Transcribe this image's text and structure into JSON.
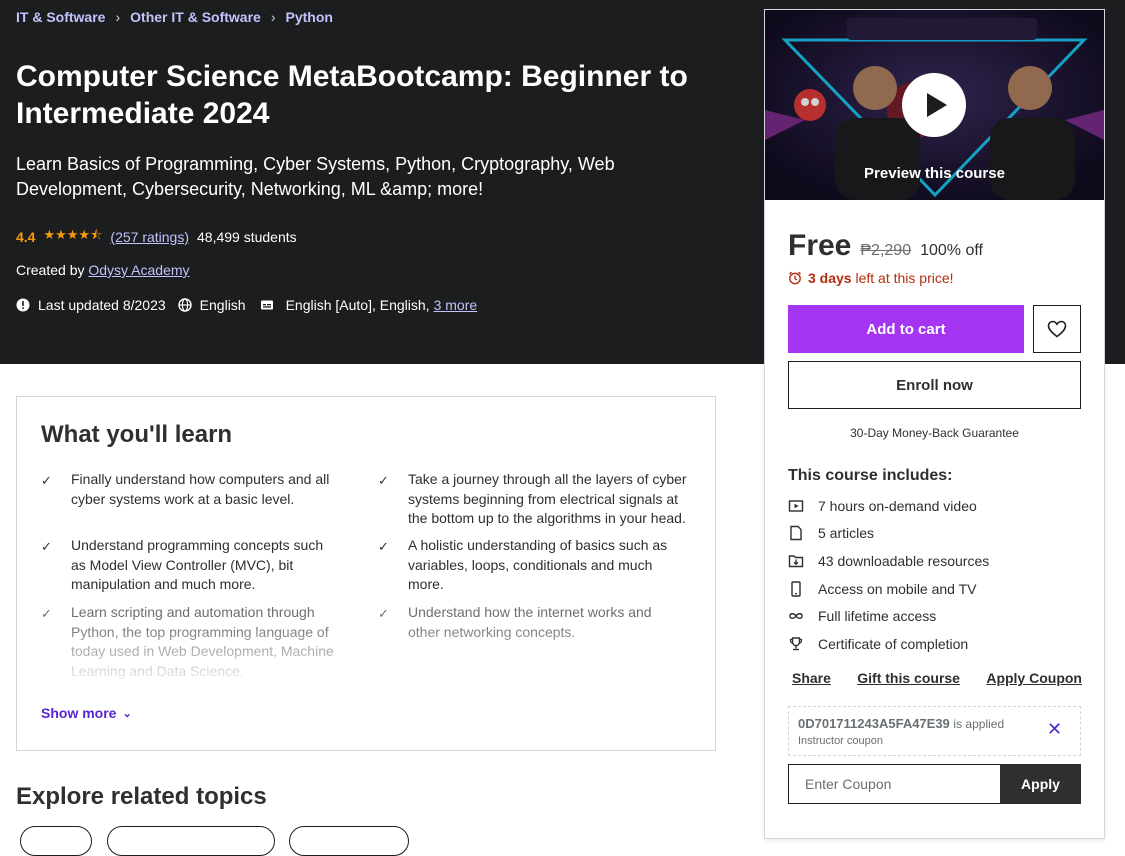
{
  "breadcrumb": [
    "IT & Software",
    "Other IT & Software",
    "Python"
  ],
  "course": {
    "title": "Computer Science MetaBootcamp: Beginner to Intermediate 2024",
    "subtitle": "Learn Basics of Programming, Cyber Systems, Python, Cryptography, Web Development, Cybersecurity, Networking, ML &amp; more!",
    "rating": "4.4",
    "ratings_link": "(257 ratings)",
    "students": "48,499 students",
    "created_by_label": "Created by",
    "author": "Odysy Academy",
    "last_updated": "Last updated 8/2023",
    "language": "English",
    "captions": "English [Auto], English,",
    "captions_more": "3 more"
  },
  "learn": {
    "title": "What you'll learn",
    "items": [
      "Finally understand how computers and all cyber systems work at a basic level.",
      "Take a journey through all the layers of cyber systems beginning from electrical signals at the bottom up to the algorithms in your head.",
      "Understand programming concepts such as Model View Controller (MVC), bit manipulation and much more.",
      "A holistic understanding of basics such as variables, loops, conditionals and much more.",
      "Learn scripting and automation through Python, the top programming language of today used in Web Development, Machine Learning and Data Science.",
      "Understand how the internet works and other networking concepts."
    ],
    "show_more": "Show more"
  },
  "explore_title": "Explore related topics",
  "card": {
    "preview_label": "Preview this course",
    "price": "Free",
    "original_price": "₱2,290",
    "discount": "100% off",
    "deadline_bold": "3 days",
    "deadline_rest": "left at this price!",
    "add_to_cart": "Add to cart",
    "enroll": "Enroll now",
    "guarantee": "30-Day Money-Back Guarantee",
    "includes_title": "This course includes:",
    "includes": [
      {
        "icon": "video-icon",
        "label": "7 hours on-demand video"
      },
      {
        "icon": "article-icon",
        "label": "5 articles"
      },
      {
        "icon": "download-icon",
        "label": "43 downloadable resources"
      },
      {
        "icon": "mobile-icon",
        "label": "Access on mobile and TV"
      },
      {
        "icon": "infinity-icon",
        "label": "Full lifetime access"
      },
      {
        "icon": "trophy-icon",
        "label": "Certificate of completion"
      }
    ],
    "share": "Share",
    "gift": "Gift this course",
    "apply_coupon": "Apply Coupon",
    "coupon_code": "0D701711243A5FA47E39",
    "coupon_applied": "is applied",
    "coupon_type": "Instructor coupon",
    "coupon_placeholder": "Enter Coupon",
    "apply": "Apply"
  },
  "colors": {
    "purple": "#a435f0",
    "dark": "#1c1d1f",
    "link_light": "#c0c4fc",
    "star": "#f69c08",
    "deadline": "#b32d0f"
  }
}
